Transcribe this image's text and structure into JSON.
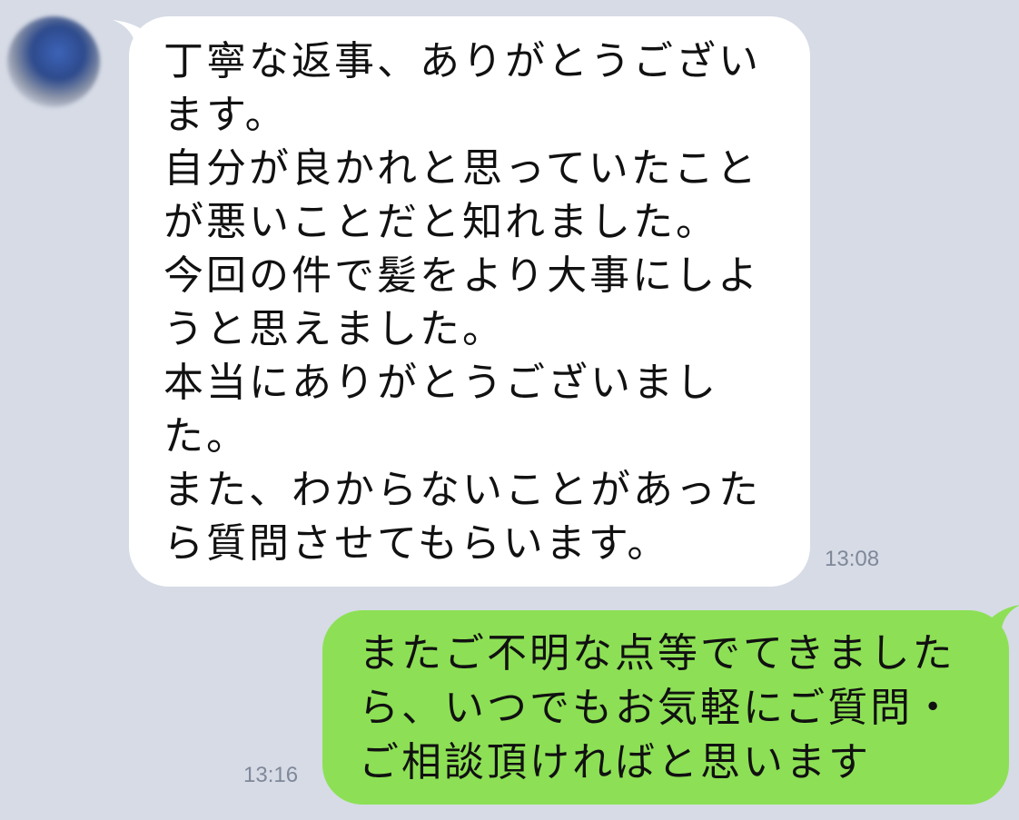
{
  "messages": [
    {
      "direction": "incoming",
      "text": "丁寧な返事、ありがとうござい\nます。\n自分が良かれと思っていたこと\nが悪いことだと知れました。\n今回の件で髪をより大事にしよ\nうと思えました。\n本当にありがとうございまし\nた。\nまた、わからないことがあった\nら質問させてもらいます。",
      "time": "13:08",
      "bubble_color": "#ffffff"
    },
    {
      "direction": "outgoing",
      "text": "またご不明な点等でてきました\nら、いつでもお気軽にご質問・\nご相談頂ければと思います",
      "time": "13:16",
      "bubble_color": "#8de055"
    }
  ],
  "colors": {
    "background": "#d6dbe6",
    "timestamp": "#7f8899"
  }
}
